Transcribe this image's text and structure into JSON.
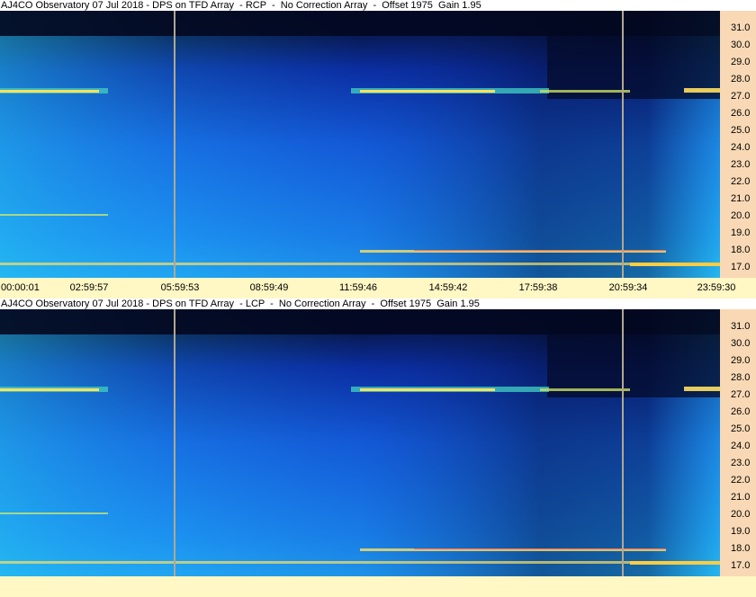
{
  "panels": [
    {
      "id": "rcp",
      "title": "AJ4CO Observatory 07 Jul 2018 - DPS on TFD Array  - RCP  -  No Correction Array  -  Offset 1975  Gain 1.95"
    },
    {
      "id": "lcp",
      "title": "AJ4CO Observatory 07 Jul 2018 - DPS on TFD Array  - LCP  -  No Correction Array  -  Offset 1975  Gain 1.95"
    }
  ],
  "freq_axis": {
    "labels": [
      "31.0",
      "30.0",
      "29.0",
      "28.0",
      "27.0",
      "26.0",
      "25.0",
      "24.0",
      "23.0",
      "22.0",
      "21.0",
      "20.0",
      "19.0",
      "18.0",
      "17.0"
    ],
    "unit_hint": "MHz",
    "range_mhz": [
      16.3,
      31.9
    ]
  },
  "time_axis": {
    "labels": [
      "00:00:01",
      "02:59:57",
      "05:59:53",
      "08:59:49",
      "11:59:46",
      "14:59:42",
      "17:59:38",
      "20:59:34",
      "23:59:30"
    ]
  },
  "colors": {
    "title_bg": "#ffffff",
    "freq_axis_bg": "#f9d9b5",
    "time_axis_bg": "#fff7c4",
    "spectrogram_base": "#1660e0",
    "spectrogram_dark": "#040a2a",
    "hot_band": "#ffee55",
    "marker_line": "#b0a890"
  }
}
